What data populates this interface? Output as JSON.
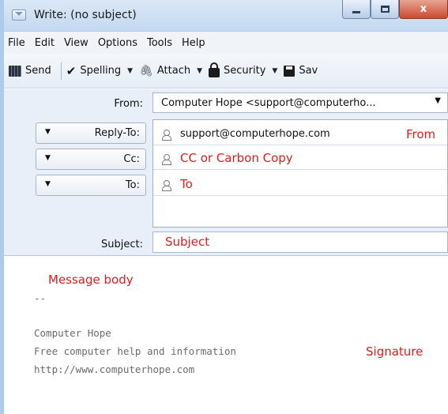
{
  "window": {
    "title": "Write: (no subject)"
  },
  "menu": [
    "File",
    "Edit",
    "View",
    "Options",
    "Tools",
    "Help"
  ],
  "toolbar": {
    "send": "Send",
    "spelling": "Spelling",
    "attach": "Attach",
    "security": "Security",
    "save": "Sav"
  },
  "header": {
    "from_label": "From:",
    "from_value": "Computer Hope <support@computerho...",
    "recipients": [
      {
        "type": "Reply-To:",
        "value": "support@computerhope.com",
        "annotation": "From"
      },
      {
        "type": "Cc:",
        "value": "CC or Carbon Copy"
      },
      {
        "type": "To:",
        "value": "To"
      }
    ],
    "subject_label": "Subject:",
    "subject_value": "Subject"
  },
  "body": {
    "annotation": "Message body",
    "separator": "--",
    "signature": [
      "Computer Hope",
      "Free computer help and information",
      "http://www.computerhope.com"
    ],
    "signature_annotation": "Signature"
  },
  "colors": {
    "annotation_red": "#e21b1b",
    "header_bg": "#e8eff8"
  }
}
